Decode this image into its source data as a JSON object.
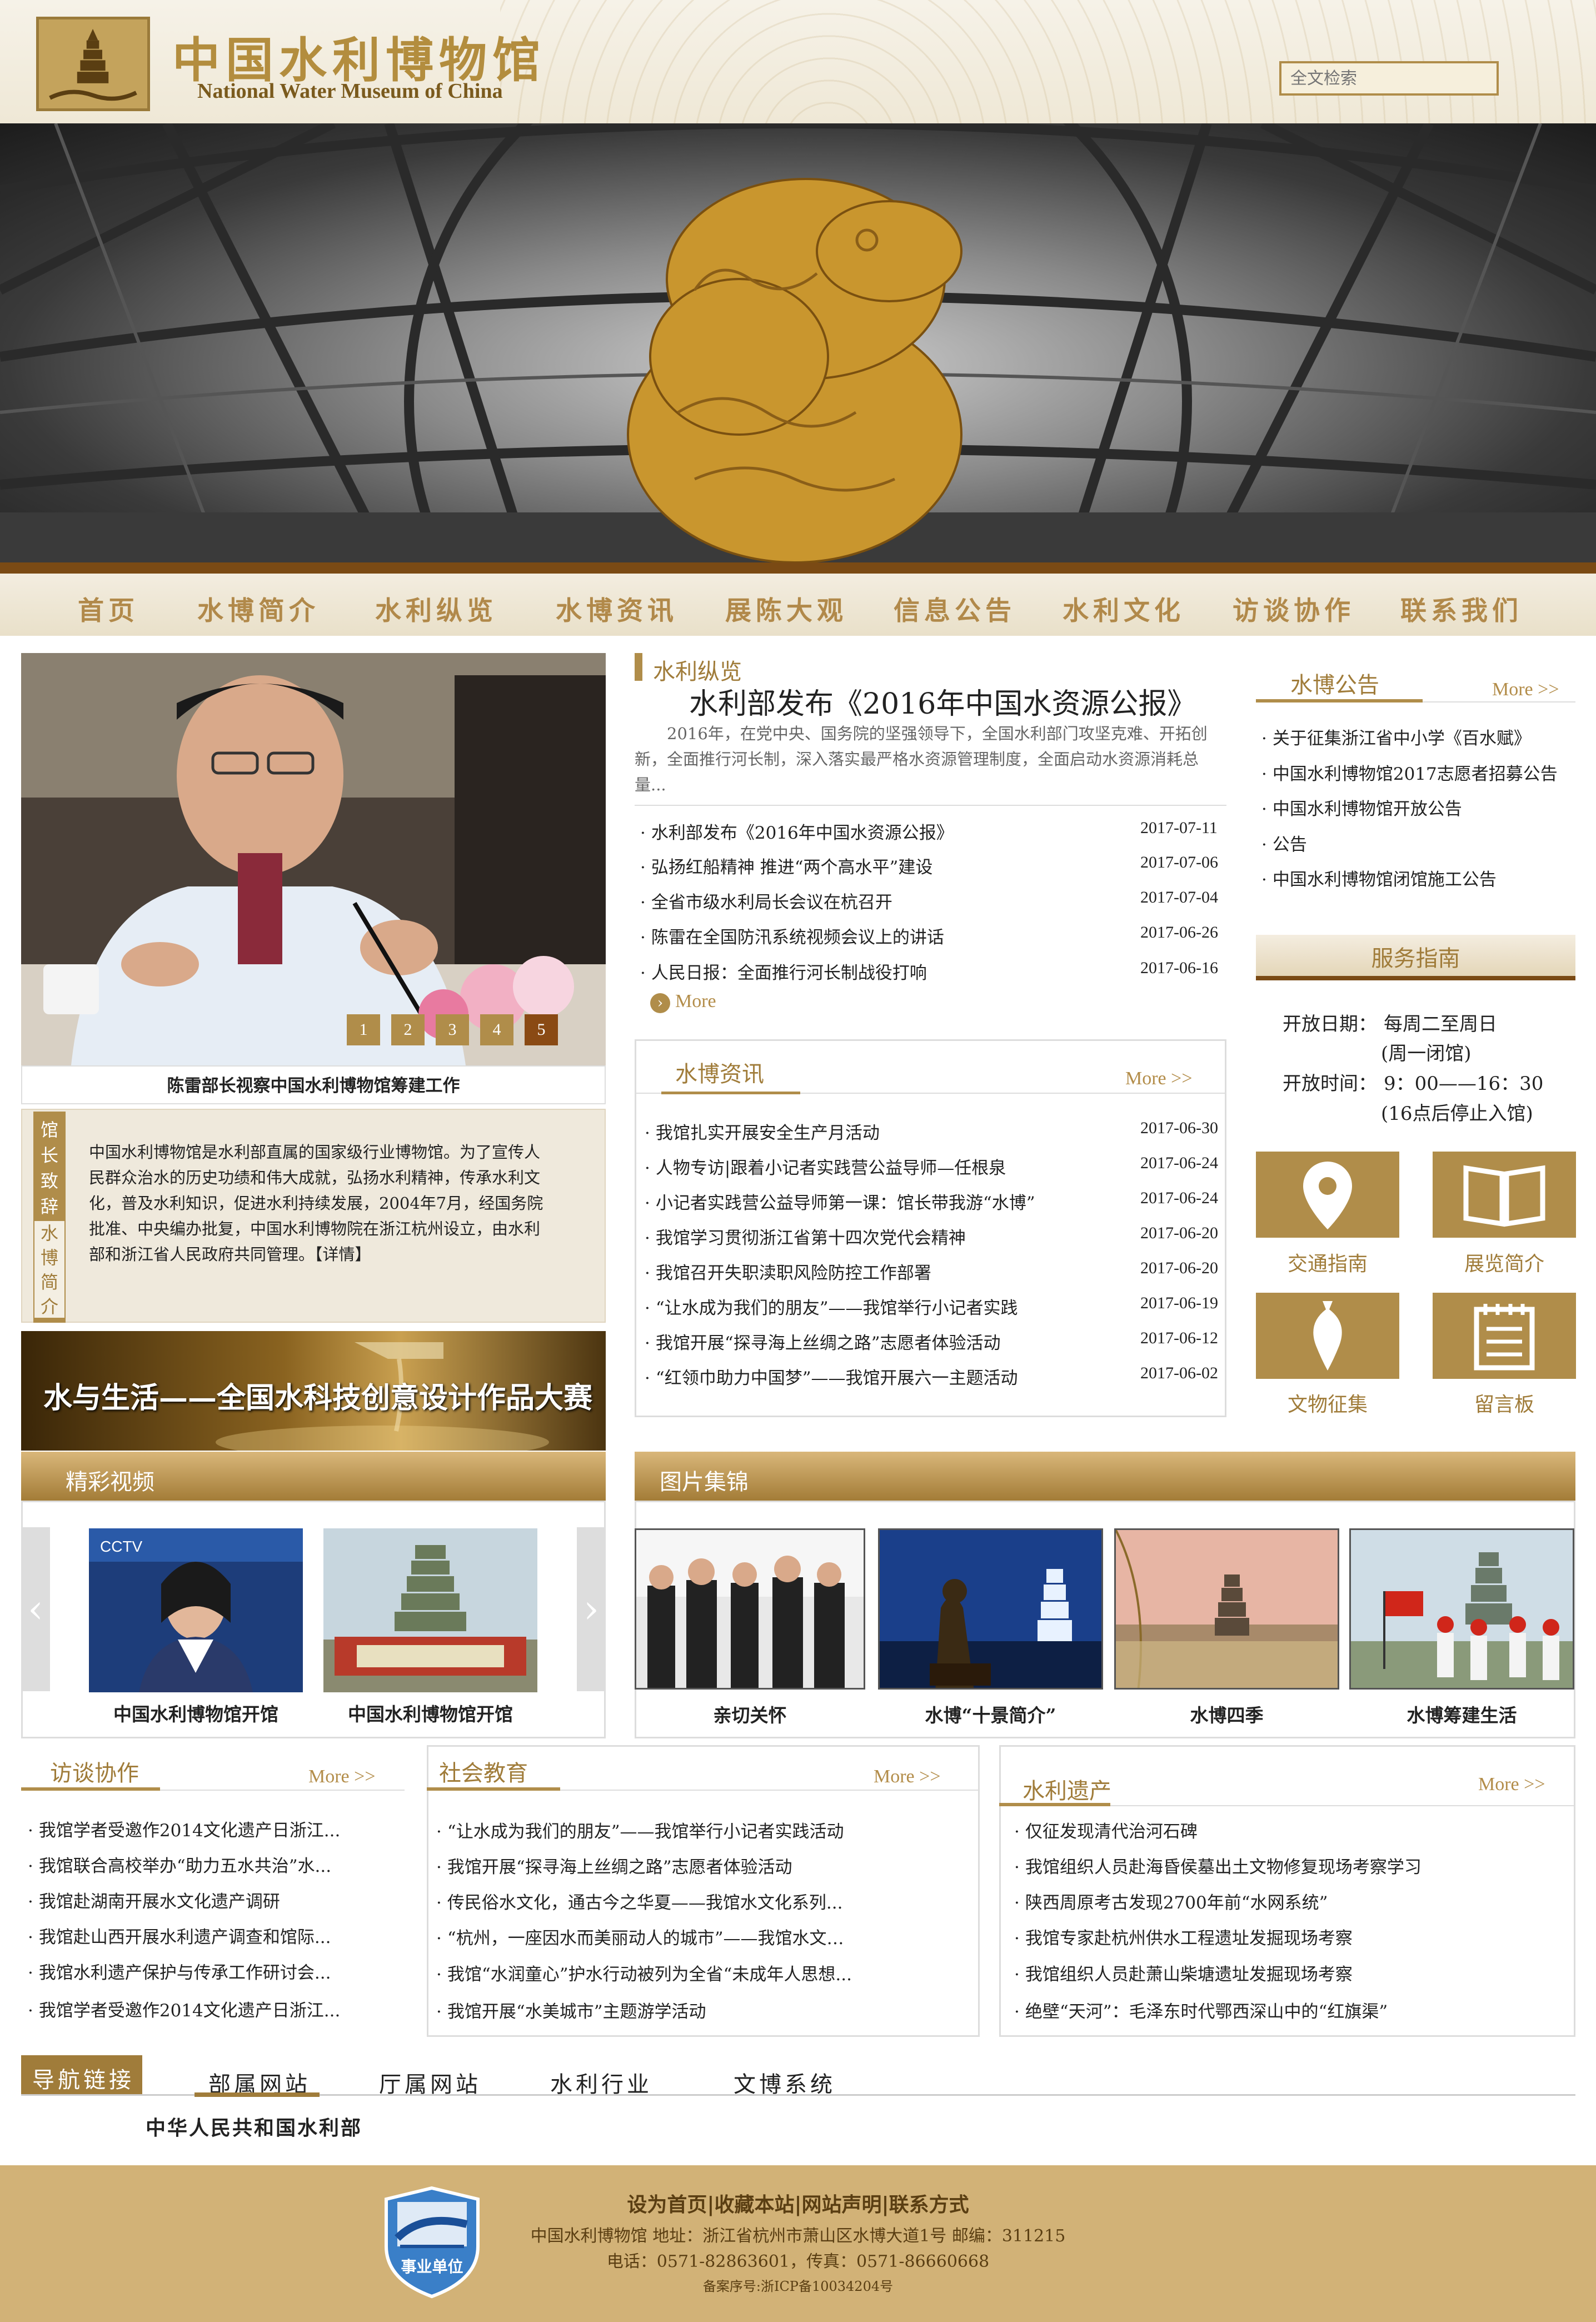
{
  "header": {
    "logo_cn": "中国水利博物馆",
    "logo_en": "National Water Museum of China",
    "search_placeholder": "全文检索"
  },
  "nav": [
    "首页",
    "水博简介",
    "水利纵览",
    "水博资讯",
    "展陈大观",
    "信息公告",
    "水利文化",
    "访谈协作",
    "联系我们"
  ],
  "feature": {
    "pager": [
      "1",
      "2",
      "3",
      "4",
      "5"
    ],
    "active_page": "5",
    "caption": "陈雷部长视察中国水利博物馆筹建工作"
  },
  "intro": {
    "tab1": [
      "馆",
      "长",
      "致",
      "辞"
    ],
    "tab2": [
      "水",
      "博",
      "简",
      "介"
    ],
    "text": "中国水利博物馆是水利部直属的国家级行业博物馆。为了宣传人民群众治水的历史功绩和伟大成就，弘扬水利精神，传承水利文化，普及水利知识，促进水利持续发展，2004年7月，经国务院批准、中央编办批复，中国水利博物院在浙江杭州设立，由水利部和浙江省人民政府共同管理。【详情】"
  },
  "water_banner": "水与生活——全国水科技创意设计作品大赛",
  "videos": {
    "title": "精彩视频",
    "items": [
      "中国水利博物馆开馆",
      "中国水利博物馆开馆"
    ]
  },
  "overview": {
    "label": "水利纵览",
    "headline": "水利部发布《2016年中国水资源公报》",
    "summary": "2016年，在党中央、国务院的坚强领导下，全国水利部门攻坚克难、开拓创新，全面推行河长制，深入落实最严格水资源管理制度，全面启动水资源消耗总量...",
    "items": [
      {
        "title": "水利部发布《2016年中国水资源公报》",
        "date": "2017-07-11"
      },
      {
        "title": "弘扬红船精神 推进“两个高水平”建设",
        "date": "2017-07-06"
      },
      {
        "title": "全省市级水利局长会议在杭召开",
        "date": "2017-07-04"
      },
      {
        "title": "陈雷在全国防汛系统视频会议上的讲话",
        "date": "2017-06-26"
      },
      {
        "title": "人民日报：全面推行河长制战役打响",
        "date": "2017-06-16"
      }
    ],
    "more": "More"
  },
  "news": {
    "title": "水博资讯",
    "more": "More >>",
    "items": [
      {
        "title": "我馆扎实开展安全生产月活动",
        "date": "2017-06-30"
      },
      {
        "title": "人物专访|跟着小记者实践营公益导师—任根泉",
        "date": "2017-06-24"
      },
      {
        "title": "小记者实践营公益导师第一课：馆长带我游“水博”",
        "date": "2017-06-24"
      },
      {
        "title": "我馆学习贯彻浙江省第十四次党代会精神",
        "date": "2017-06-20"
      },
      {
        "title": "我馆召开失职渎职风险防控工作部署",
        "date": "2017-06-20"
      },
      {
        "title": "“让水成为我们的朋友”——我馆举行小记者实践",
        "date": "2017-06-19"
      },
      {
        "title": "我馆开展“探寻海上丝绸之路”志愿者体验活动",
        "date": "2017-06-12"
      },
      {
        "title": "“红领巾助力中国梦”——我馆开展六一主题活动",
        "date": "2017-06-02"
      }
    ]
  },
  "gallery": {
    "title": "图片集锦",
    "items": [
      "亲切关怀",
      "水博“十景简介”",
      "水博四季",
      "水博筹建生活"
    ]
  },
  "notices": {
    "title": "水博公告",
    "more": "More >>",
    "items": [
      "关于征集浙江省中小学《百水赋》",
      "中国水利博物馆2017志愿者招募公告",
      "中国水利博物馆开放公告",
      "公告",
      "中国水利博物馆闭馆施工公告"
    ]
  },
  "service": {
    "title": "服务指南",
    "open_days_label": "开放日期：",
    "open_days": "每周二至周日",
    "open_days_note": "(周一闭馆)",
    "open_time_label": "开放时间：",
    "open_time": "9：00——16：30",
    "open_time_note": "(16点后停止入馆)",
    "tiles": [
      "交通指南",
      "展览简介",
      "文物征集",
      "留言板"
    ]
  },
  "interview": {
    "title": "访谈协作",
    "more": "More >>",
    "items": [
      "我馆学者受邀作2014文化遗产日浙江...",
      "我馆联合高校举办“助力五水共治”水...",
      "我馆赴湖南开展水文化遗产调研",
      "我馆赴山西开展水利遗产调查和馆际...",
      "我馆水利遗产保护与传承工作研讨会...",
      "我馆学者受邀作2014文化遗产日浙江..."
    ]
  },
  "education": {
    "title": "社会教育",
    "more": "More >>",
    "items": [
      "“让水成为我们的朋友”——我馆举行小记者实践活动",
      "我馆开展“探寻海上丝绸之路”志愿者体验活动",
      "传民俗水文化，通古今之华夏——我馆水文化系列...",
      "“杭州，一座因水而美丽动人的城市”——我馆水文…",
      "我馆“水润童心”护水行动被列为全省“未成年人思想...",
      "我馆开展“水美城市”主题游学活动"
    ]
  },
  "heritage": {
    "title": "水利遗产",
    "more": "More >>",
    "items": [
      "仅征发现清代治河石碑",
      "我馆组织人员赴海昏侯墓出土文物修复现场考察学习",
      "陕西周原考古发现2700年前“水网系统”",
      "我馆专家赴杭州供水工程遗址发掘现场考察",
      "我馆组织人员赴萧山柴塘遗址发掘现场考察",
      "绝壁“天河”：毛泽东时代鄂西深山中的“红旗渠”"
    ]
  },
  "links": {
    "label": "导航链接",
    "tabs": [
      "部属网站",
      "厅属网站",
      "水利行业",
      "文博系统"
    ],
    "active": "中华人民共和国水利部"
  },
  "footer": {
    "links": "设为首页|收藏本站|网站声明|联系方式",
    "address": "中国水利博物馆 地址：浙江省杭州市萧山区水博大道1号 邮编：311215",
    "phone": "电话：0571-82863601，传真：0571-86660668",
    "icp": "备案序号:浙ICP备10034204号",
    "badge": "事业单位"
  },
  "colors": {
    "gold": "#b08d4a",
    "brown": "#7a4a14",
    "footer": "#d2b277"
  }
}
